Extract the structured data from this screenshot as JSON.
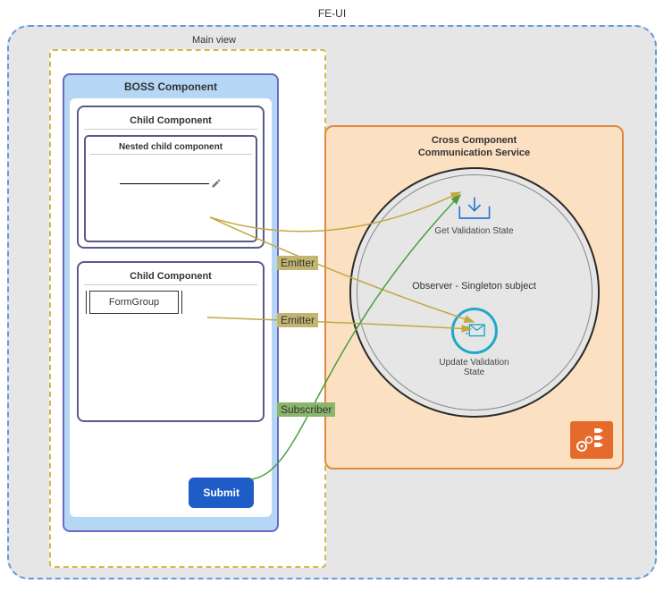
{
  "outer": {
    "title": "FE-UI"
  },
  "mainView": {
    "title": "Main view"
  },
  "boss": {
    "title": "BOSS Component",
    "child1": {
      "title": "Child Component",
      "nested": {
        "title": "Nested child component"
      }
    },
    "child2": {
      "title": "Child Component",
      "formGroup": "FormGroup"
    },
    "submit": "Submit"
  },
  "service": {
    "titleLine1": "Cross Component",
    "titleLine2": "Communication Service",
    "observer": "Observer - Singleton subject",
    "getValidation": "Get Validation State",
    "updateValidationLine1": "Update  Validation",
    "updateValidationLine2": "State"
  },
  "arrows": {
    "emitter1": "Emitter",
    "emitter2": "Emitter",
    "subscriber": "Subscriber"
  },
  "colors": {
    "feuiBorder": "#639ae5",
    "mainViewBorder": "#d3b84a",
    "bossBg": "#b5d6f5",
    "serviceBg": "#fbe1c2",
    "serviceBorder": "#e08a3f",
    "submit": "#1e5dc7",
    "iconBlue": "#1fa8c9",
    "gearsBg": "#e66a2c"
  }
}
